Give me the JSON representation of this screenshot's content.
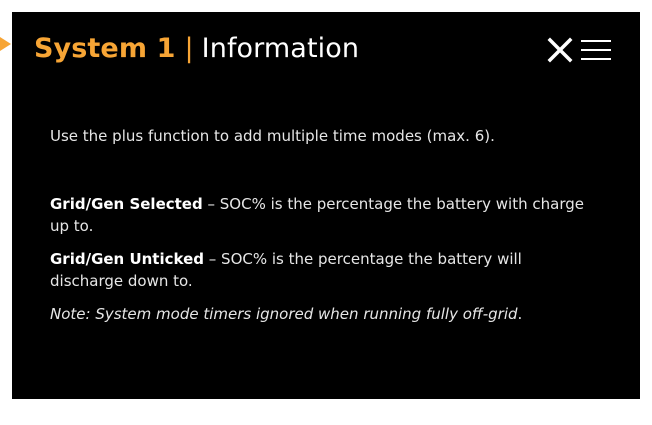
{
  "header": {
    "system_label": "System 1",
    "separator": "|",
    "section_label": "Information"
  },
  "icons": {
    "close": "close-icon",
    "menu": "hamburger-menu-icon"
  },
  "content": {
    "intro": "Use the plus function to add multiple time modes (max. 6).",
    "items": [
      {
        "term": "Grid/Gen Selected",
        "dash": " – ",
        "description": "SOC% is the percentage the battery with charge up to."
      },
      {
        "term": "Grid/Gen Unticked",
        "dash": " – ",
        "description": "SOC% is the percentage the battery will discharge down to."
      }
    ],
    "note": "Note: System mode timers ignored when running fully off-grid",
    "note_suffix": "."
  },
  "colors": {
    "accent": "#f7a535",
    "panel_background": "#000000",
    "text": "#e6e6e6"
  }
}
